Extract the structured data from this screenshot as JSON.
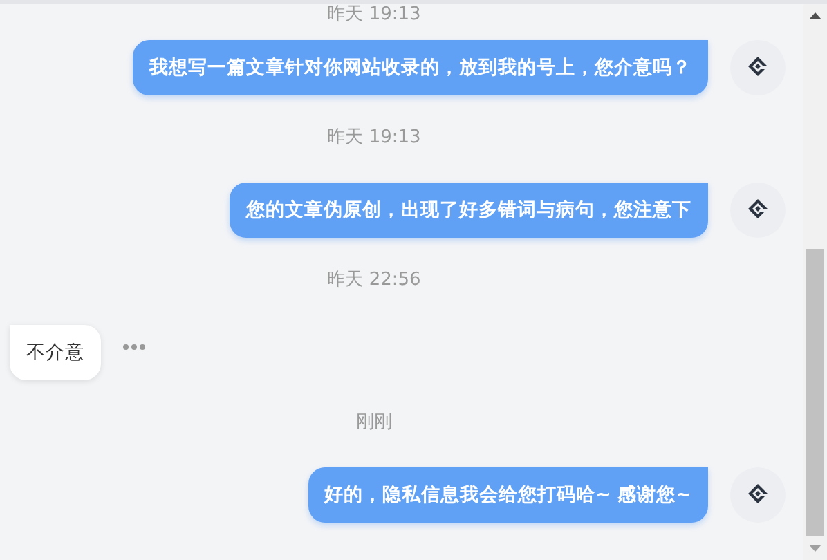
{
  "messages": [
    {
      "kind": "time",
      "text": "昨天 19:13"
    },
    {
      "kind": "sent",
      "text": "我想写一篇文章针对你网站收录的，放到我的号上，您介意吗？"
    },
    {
      "kind": "time",
      "text": "昨天 19:13"
    },
    {
      "kind": "sent",
      "text": "您的文章伪原创，出现了好多错词与病句，您注意下"
    },
    {
      "kind": "time",
      "text": "昨天 22:56"
    },
    {
      "kind": "received",
      "text": "不介意"
    },
    {
      "kind": "time",
      "text": "刚刚"
    },
    {
      "kind": "sent",
      "text": "好的，隐私信息我会给您打码哈~ 感谢您~"
    }
  ]
}
